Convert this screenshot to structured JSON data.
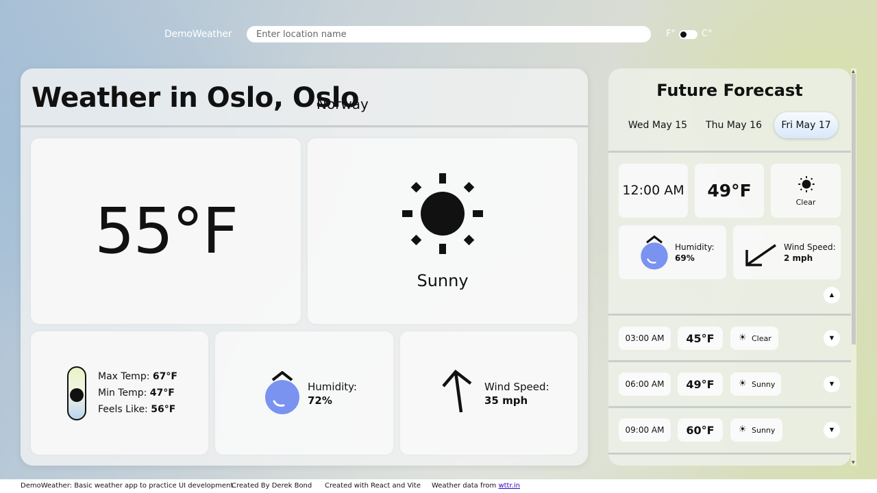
{
  "header": {
    "brand": "DemoWeather",
    "search_placeholder": "Enter location name",
    "unit_f": "F°",
    "unit_c": "C°"
  },
  "main": {
    "title": "Weather in Oslo, Oslo",
    "country": "Norway",
    "temperature": "55°F",
    "condition": "Sunny",
    "temps": {
      "max_label": "Max Temp:",
      "max_value": "67°F",
      "min_label": "Min Temp:",
      "min_value": "47°F",
      "feels_label": "Feels Like:",
      "feels_value": "56°F"
    },
    "humidity": {
      "label": "Humidity:",
      "value": "72%"
    },
    "wind": {
      "label": "Wind Speed:",
      "value": "35 mph"
    }
  },
  "forecast": {
    "title": "Future Forecast",
    "tabs": [
      "Wed May 15",
      "Thu May 16",
      "Fri May 17"
    ],
    "active_tab": "Fri May 17",
    "expanded": {
      "time": "12:00 AM",
      "temp": "49°F",
      "condition": "Clear",
      "humidity_label": "Humidity:",
      "humidity_value": "69%",
      "wind_label": "Wind Speed:",
      "wind_value": "2 mph",
      "collapse_icon": "▲"
    },
    "rows": [
      {
        "time": "03:00 AM",
        "temp": "45°F",
        "condition": "Clear",
        "expand_icon": "▼"
      },
      {
        "time": "06:00 AM",
        "temp": "49°F",
        "condition": "Sunny",
        "expand_icon": "▼"
      },
      {
        "time": "09:00 AM",
        "temp": "60°F",
        "condition": "Sunny",
        "expand_icon": "▼"
      }
    ]
  },
  "footer": {
    "about": "DemoWeather: Basic weather app to practice UI development",
    "author": "Created By Derek Bond",
    "tech": "Created with React and Vite",
    "data_prefix": "Weather data from",
    "data_link": "wttr.in"
  },
  "colors": {
    "accent_blue": "#7a92f0",
    "brand_text": "#ffffff"
  },
  "icons": {
    "sun": "sun-icon",
    "drop": "water-drop-icon",
    "arrow": "wind-arrow-icon",
    "thermometer": "thermometer-icon"
  }
}
